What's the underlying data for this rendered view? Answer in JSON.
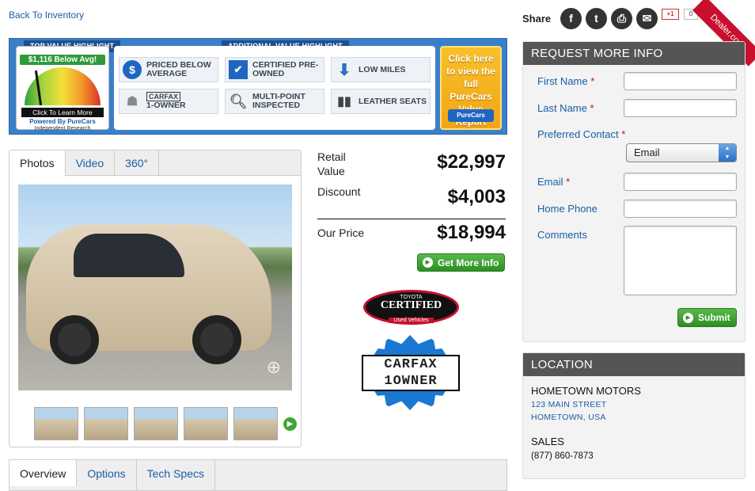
{
  "nav": {
    "back_label": "Back To Inventory"
  },
  "value_highlight": {
    "top_label": "TOP VALUE HIGHLIGHT",
    "additional_label": "ADDITIONAL VALUE HIGHLIGHT",
    "below_avg": "$1,116 Below Avg!",
    "click_to_learn": "Click To Learn More",
    "powered_by": "Powered By PureCars",
    "independent": "Independent Research",
    "items": [
      {
        "label": "PRICED BELOW AVERAGE",
        "icon": "dollar-icon"
      },
      {
        "label": "CERTIFIED PRE-OWNED",
        "icon": "checkbox-icon"
      },
      {
        "label": "LOW MILES",
        "icon": "down-arrow-icon"
      },
      {
        "label": "1-OWNER",
        "icon": "carfax-icon",
        "brand": "CARFAX"
      },
      {
        "label": "MULTI-POINT INSPECTED",
        "icon": "magnifier-icon"
      },
      {
        "label": "LEATHER SEATS",
        "icon": "seats-icon"
      }
    ],
    "report_cta": "Click here to view the full PureCars Value Report",
    "report_badge": "PureCars"
  },
  "media": {
    "tabs": [
      "Photos",
      "Video",
      "360°"
    ],
    "active_tab": "Photos",
    "thumbnail_count": 5
  },
  "pricing": {
    "retail_label": "Retail Value",
    "retail_value": "$22,997",
    "discount_label": "Discount",
    "discount_value": "$4,003",
    "our_price_label": "Our Price",
    "our_price_value": "$18,994",
    "cta": "Get More Info"
  },
  "badges": {
    "toyota_top": "TOYOTA",
    "toyota_main": "CERTIFIED",
    "toyota_sub": "Used Vehicles",
    "carfax_line1": "CARFAX",
    "carfax_line2": "1OWNER"
  },
  "bottom_tabs": [
    "Overview",
    "Options",
    "Tech Specs"
  ],
  "share": {
    "label": "Share",
    "gplus": "+1",
    "gcount": "0",
    "ribbon": "Dealer.com"
  },
  "form": {
    "title": "REQUEST MORE INFO",
    "first_name": "First Name",
    "last_name": "Last Name",
    "preferred_contact": "Preferred Contact",
    "contact_value": "Email",
    "email": "Email",
    "home_phone": "Home Phone",
    "comments": "Comments",
    "required_marker": "*",
    "submit": "Submit"
  },
  "location": {
    "title": "LOCATION",
    "dealer": "HOMETOWN MOTORS",
    "street": "123 MAIN STREET",
    "city": "HOMETOWN, USA",
    "sales_label": "SALES",
    "sales_phone": "(877) 860-7873"
  },
  "colors": {
    "link": "#1a5da6",
    "accent_green": "#2d8e22",
    "header_gray": "#555555",
    "banner_blue": "#3a7fc9",
    "ribbon_red": "#c8102e"
  }
}
